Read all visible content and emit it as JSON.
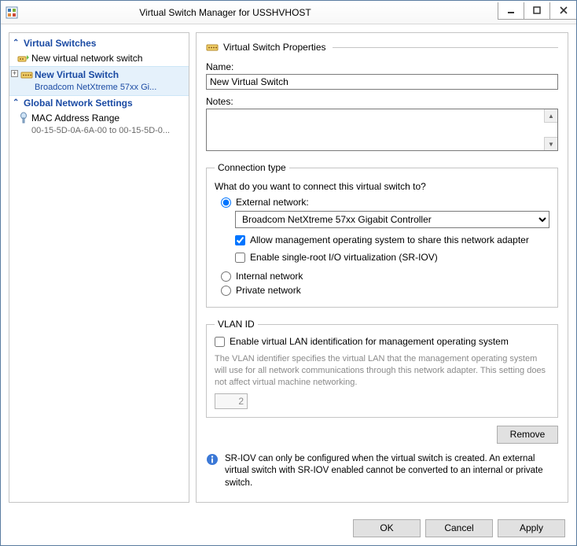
{
  "window": {
    "title": "Virtual Switch Manager for USSHVHOST"
  },
  "tree": {
    "virtual_switches_header": "Virtual Switches",
    "new_switch_item": "New virtual network switch",
    "selected": {
      "label": "New Virtual Switch",
      "sublabel": "Broadcom NetXtreme 57xx Gi..."
    },
    "global_header": "Global Network Settings",
    "mac": {
      "label": "MAC Address Range",
      "sublabel": "00-15-5D-0A-6A-00 to 00-15-5D-0..."
    }
  },
  "props": {
    "section_title": "Virtual Switch Properties",
    "name_label": "Name:",
    "name_value": "New Virtual Switch",
    "notes_label": "Notes:"
  },
  "conn": {
    "legend": "Connection type",
    "question": "What do you want to connect this virtual switch to?",
    "external_label": "External network:",
    "adapter": "Broadcom NetXtreme 57xx Gigabit Controller",
    "allow_mgmt": "Allow management operating system to share this network adapter",
    "sriov": "Enable single-root I/O virtualization (SR-IOV)",
    "internal_label": "Internal network",
    "private_label": "Private network"
  },
  "vlan": {
    "legend": "VLAN ID",
    "enable": "Enable virtual LAN identification for management operating system",
    "help": "The VLAN identifier specifies the virtual LAN that the management operating system will use for all network communications through this network adapter. This setting does not affect virtual machine networking.",
    "value": "2"
  },
  "remove_label": "Remove",
  "sriov_note": "SR-IOV can only be configured when the virtual switch is created. An external virtual switch with SR-IOV enabled cannot be converted to an internal or private switch.",
  "footer": {
    "ok": "OK",
    "cancel": "Cancel",
    "apply": "Apply"
  }
}
